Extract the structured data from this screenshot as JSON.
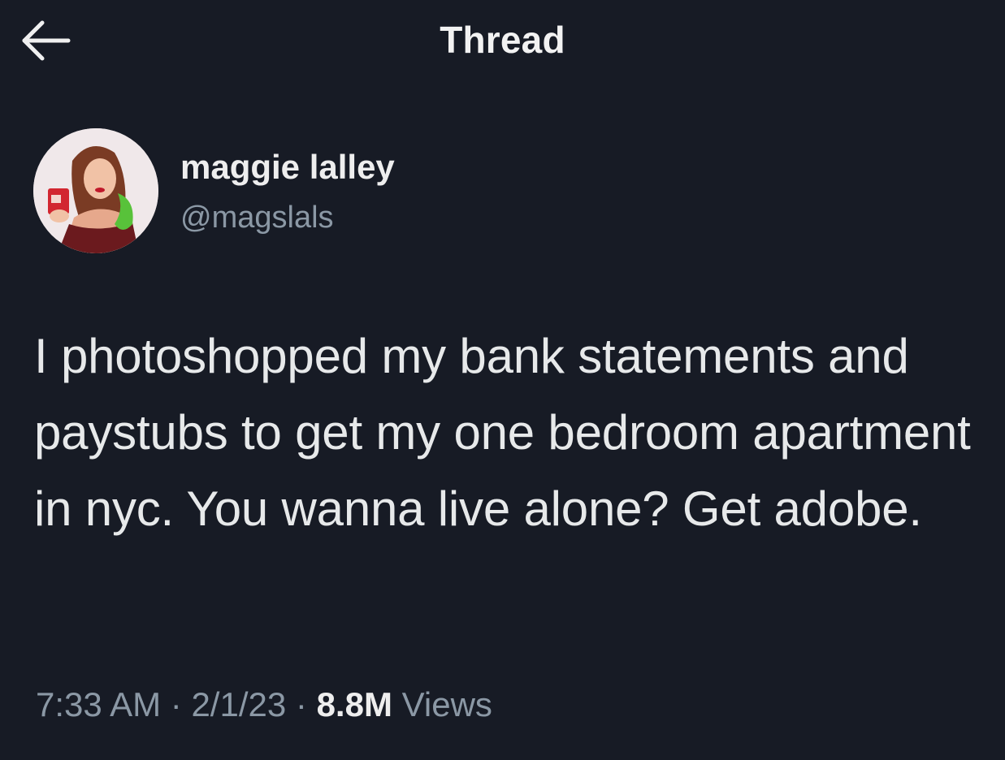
{
  "header": {
    "title": "Thread",
    "back_icon": "arrow-left-icon"
  },
  "author": {
    "display_name": "maggie lalley",
    "handle": "@magslals",
    "avatar_icon": "profile-photo"
  },
  "tweet": {
    "text": "I photoshopped my bank statements and paystubs to get my one bedroom apartment in nyc. You wanna live alone? Get adobe.",
    "time": "7:33 AM",
    "separator": "·",
    "date": "2/1/23",
    "views_count": "8.8M",
    "views_label": "Views"
  },
  "colors": {
    "background": "#171b25",
    "text_primary": "#e7e9ea",
    "text_secondary": "#8b98a5"
  }
}
